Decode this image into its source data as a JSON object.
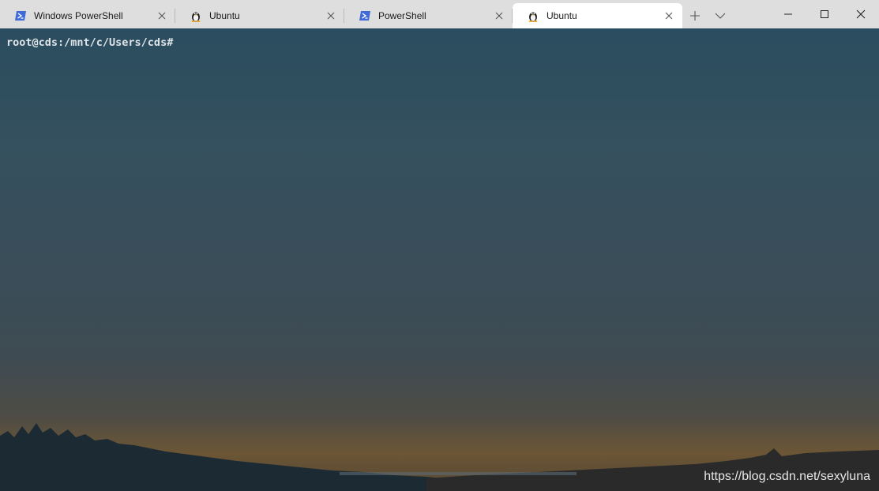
{
  "tabs": [
    {
      "label": "Windows PowerShell",
      "icon": "powershell-icon",
      "active": false
    },
    {
      "label": "Ubuntu",
      "icon": "linux-tux-icon",
      "active": false
    },
    {
      "label": "PowerShell",
      "icon": "powershell-icon",
      "active": false
    },
    {
      "label": "Ubuntu",
      "icon": "linux-tux-icon",
      "active": true
    }
  ],
  "terminal": {
    "prompt": "root@cds:/mnt/c/Users/cds#"
  },
  "watermark": "https://blog.csdn.net/sexyluna",
  "colors": {
    "titlebar": "#dedede",
    "active_tab": "#ffffff",
    "powershell_blue": "#3e6bd6",
    "prompt_text": "#dfe4e8"
  }
}
